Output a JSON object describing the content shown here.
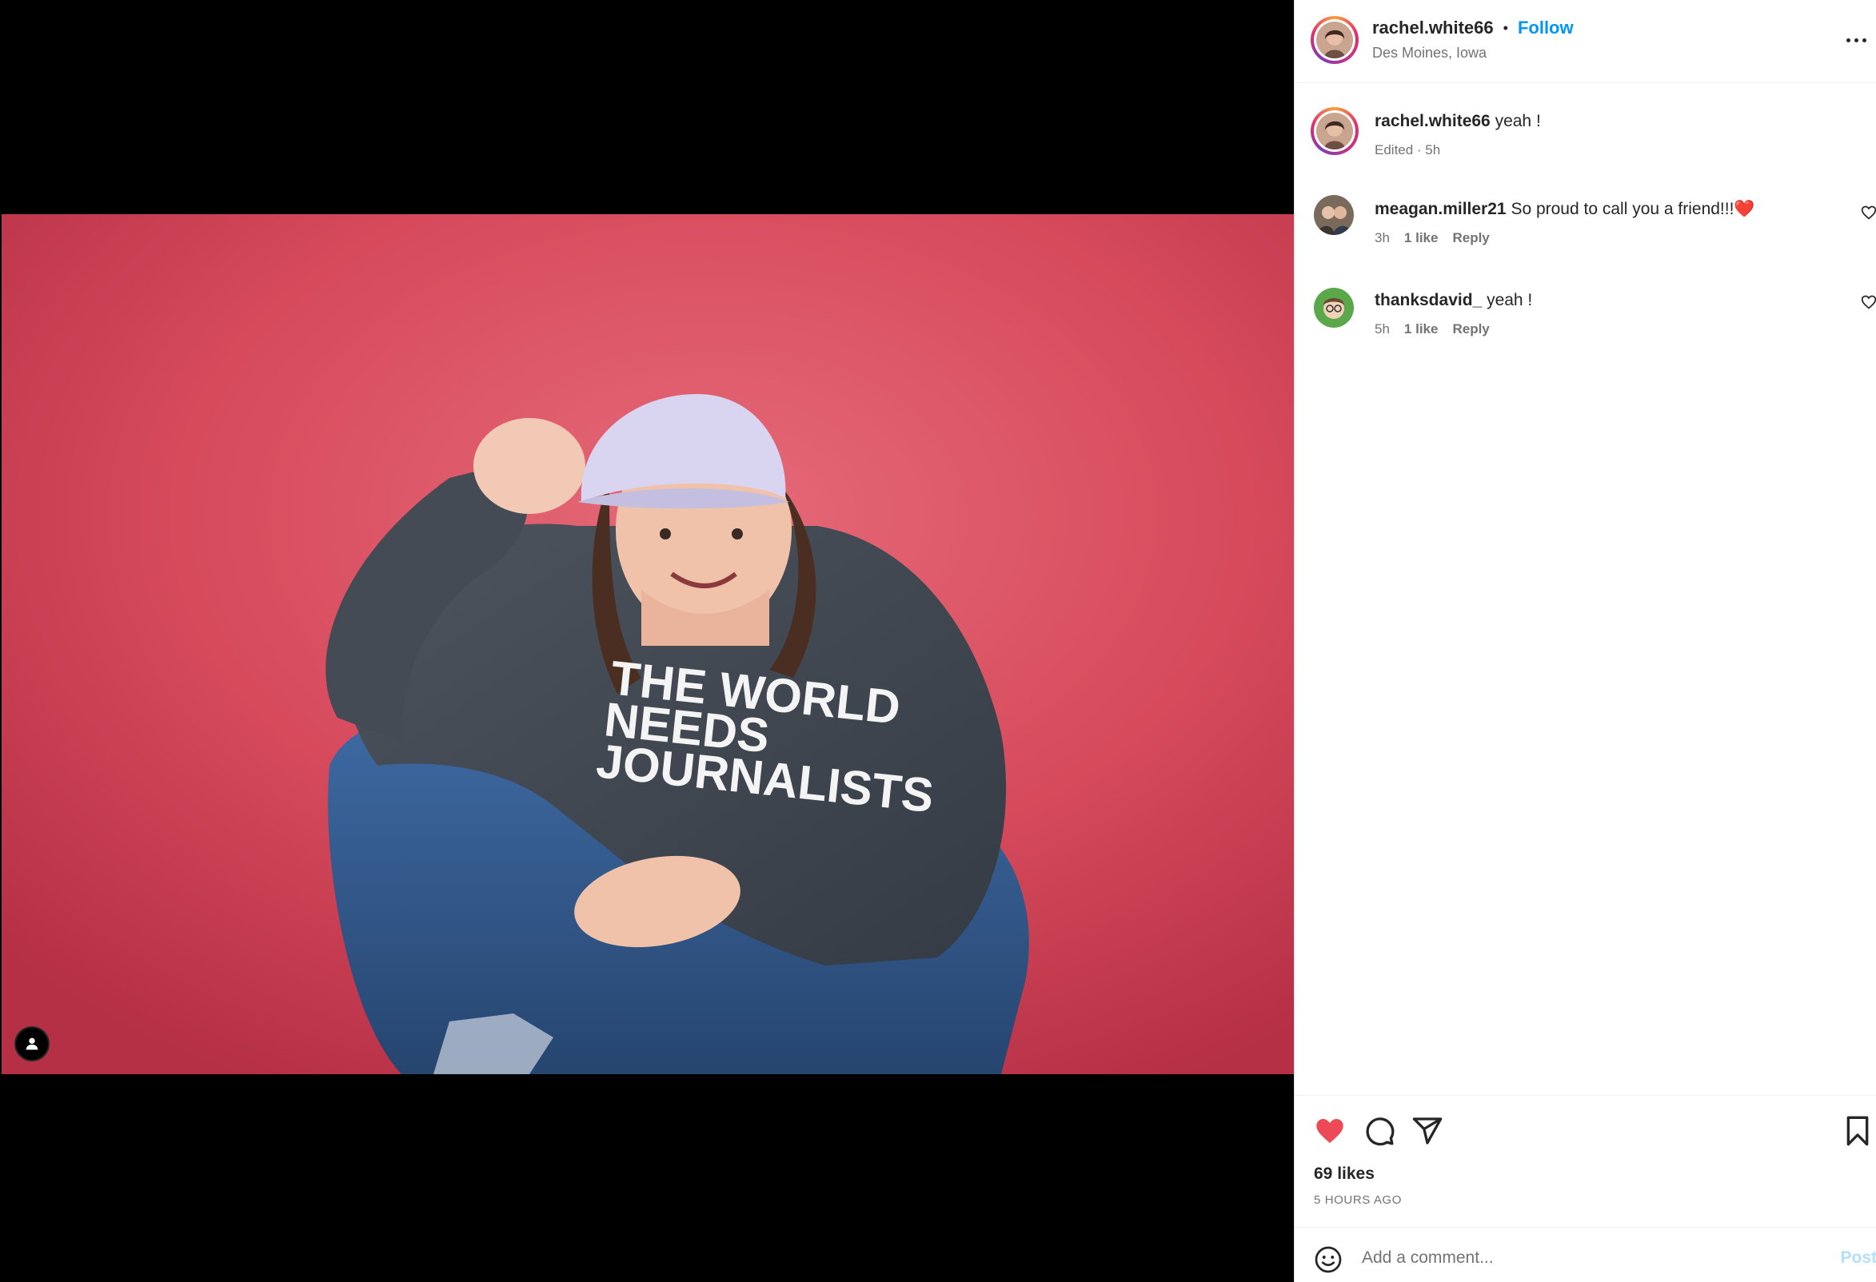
{
  "post": {
    "author": "rachel.white66",
    "separator": "•",
    "follow_label": "Follow",
    "location": "Des Moines, Iowa",
    "more_icon": "more-horizontal-icon"
  },
  "caption": {
    "username": "rachel.white66",
    "text": "yeah !",
    "meta": "Edited · 5h"
  },
  "comments": [
    {
      "username": "meagan.miller21",
      "text": "So proud to call you a friend!!!❤️",
      "time": "3h",
      "likes": "1 like",
      "reply": "Reply"
    },
    {
      "username": "thanksdavid_",
      "text": "yeah !",
      "time": "5h",
      "likes": "1 like",
      "reply": "Reply"
    }
  ],
  "image": {
    "shirt_text_line1": "THE WORLD",
    "shirt_text_line2": "NEEDS",
    "shirt_text_line3": "JOURNALISTS"
  },
  "actions": {
    "liked": true,
    "like_color": "#ed4956",
    "likes_count": "69 likes",
    "time_ago": "5 HOURS AGO"
  },
  "composer": {
    "placeholder": "Add a comment...",
    "post_label": "Post",
    "post_color_disabled": "#b2dffc"
  },
  "colors": {
    "accent_blue": "#0095f6",
    "background_red": "#d94a5d"
  }
}
